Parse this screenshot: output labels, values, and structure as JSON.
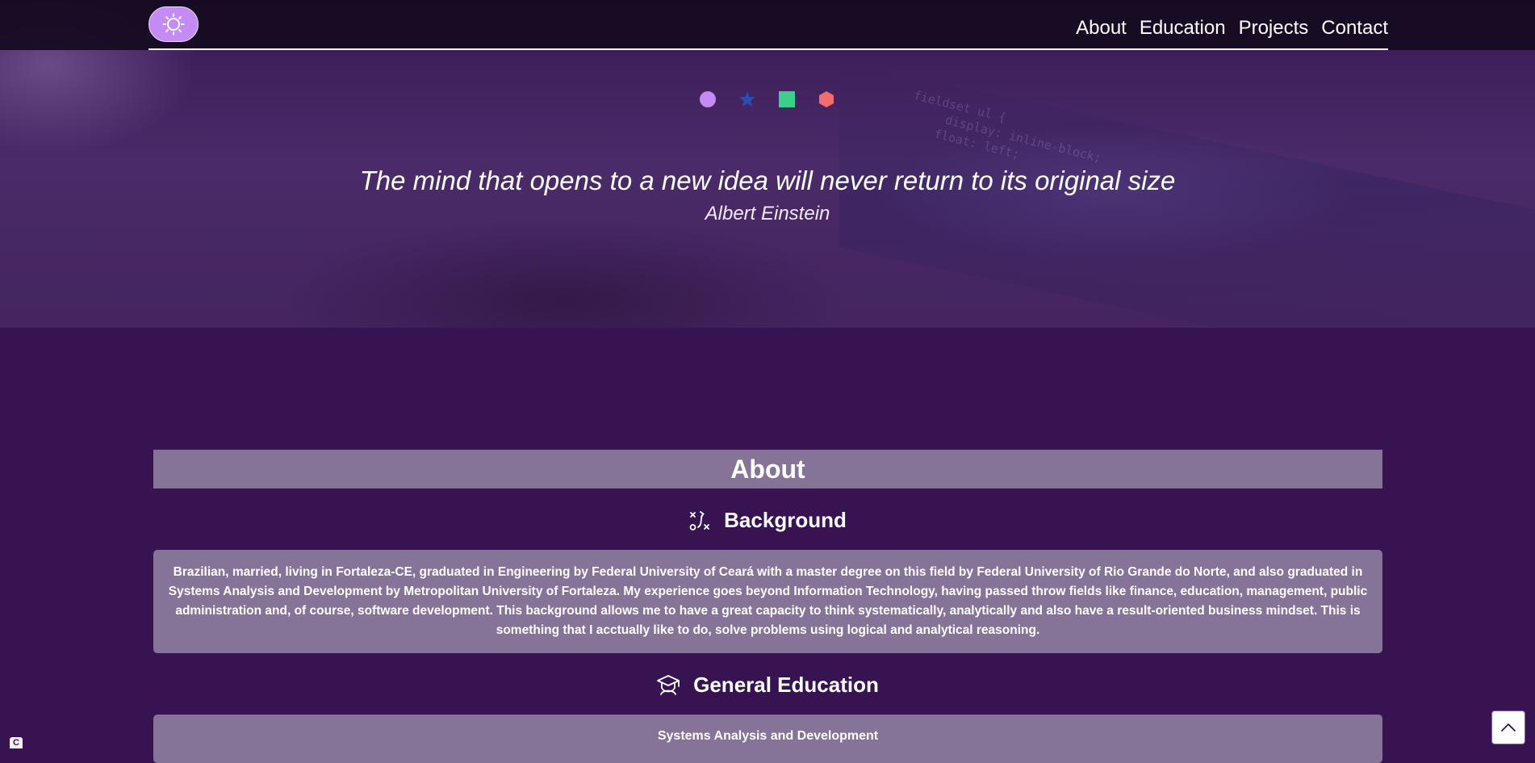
{
  "nav": {
    "links": [
      {
        "label": "About"
      },
      {
        "label": "Education"
      },
      {
        "label": "Projects"
      },
      {
        "label": "Contact"
      }
    ]
  },
  "theme_toggle": {
    "icon": "sun-icon"
  },
  "hero": {
    "code_snippet": "fieldset ul {\n     display: inline-block;\n    float: left;",
    "shapes": [
      {
        "icon": "circle-icon",
        "color": "#c48bf5"
      },
      {
        "icon": "star-icon",
        "color": "#2a4fb0"
      },
      {
        "icon": "square-icon",
        "color": "#3ad08c"
      },
      {
        "icon": "hexagon-icon",
        "color": "#f26d6d"
      }
    ],
    "quote": "The mind that opens to a new idea will never return to its original size",
    "author": "Albert Einstein"
  },
  "about": {
    "title": "About",
    "background": {
      "icon": "strategy-icon",
      "heading": "Background",
      "text": "Brazilian, married, living in Fortaleza-CE, graduated in Engineering by Federal University of Ceará with a master degree on this field by Federal University of Rio Grande do Norte, and also graduated in Systems Analysis and Development by Metropolitan University of Fortaleza. My experience goes beyond Information Technology, having passed throw fields like finance, education, management, public administration and, of course, software development. This background allows me to have a great capacity to think systematically, analytically and also have a result-oriented business mindset. This is something that I acctually like to do, solve problems using logical and analytical reasoning."
    },
    "general_education": {
      "icon": "graduation-cap-icon",
      "heading": "General Education",
      "first_item": "Systems Analysis and Development"
    }
  },
  "scroll_top": {
    "icon": "chevron-up-icon"
  },
  "corner_badge": {
    "label": "C"
  },
  "colors": {
    "background": "#371352",
    "card": "#857497",
    "toggle": "#c48bf5",
    "navbar": "#160a20"
  }
}
